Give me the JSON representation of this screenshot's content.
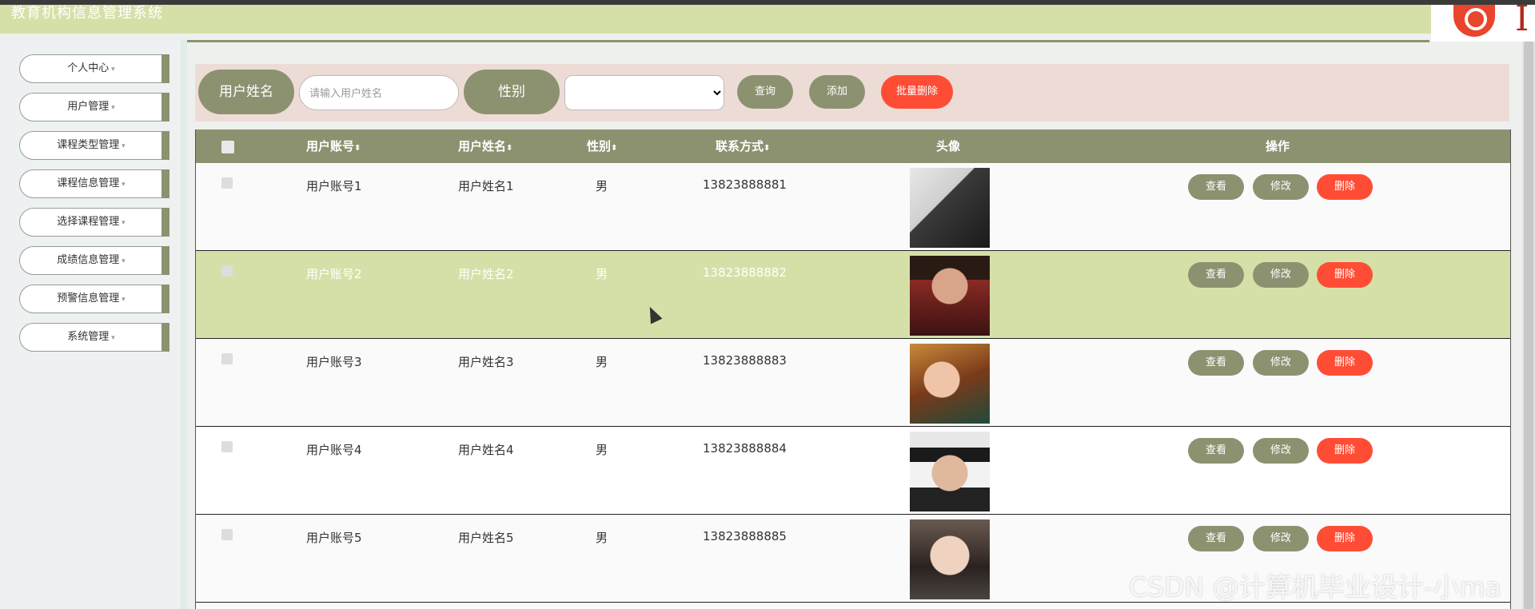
{
  "header": {
    "title": "教育机构信息管理系统"
  },
  "sidebar": {
    "items": [
      {
        "label": "个人中心"
      },
      {
        "label": "用户管理"
      },
      {
        "label": "课程类型管理"
      },
      {
        "label": "课程信息管理"
      },
      {
        "label": "选择课程管理"
      },
      {
        "label": "成绩信息管理"
      },
      {
        "label": "预警信息管理"
      },
      {
        "label": "系统管理"
      }
    ]
  },
  "search": {
    "name_label": "用户姓名",
    "name_placeholder": "请输入用户姓名",
    "gender_label": "性别",
    "gender_value": "",
    "query_button": "查询",
    "add_button": "添加",
    "batch_delete_button": "批量删除"
  },
  "table": {
    "columns": {
      "account": "用户账号",
      "name": "用户姓名",
      "gender": "性别",
      "phone": "联系方式",
      "avatar": "头像",
      "actions": "操作"
    },
    "sort_glyph": "⬍",
    "rows": [
      {
        "account": "用户账号1",
        "name": "用户姓名1",
        "gender": "男",
        "phone": "13823888881"
      },
      {
        "account": "用户账号2",
        "name": "用户姓名2",
        "gender": "男",
        "phone": "13823888882"
      },
      {
        "account": "用户账号3",
        "name": "用户姓名3",
        "gender": "男",
        "phone": "13823888883"
      },
      {
        "account": "用户账号4",
        "name": "用户姓名4",
        "gender": "男",
        "phone": "13823888884"
      },
      {
        "account": "用户账号5",
        "name": "用户姓名5",
        "gender": "男",
        "phone": "13823888885"
      }
    ],
    "actions": {
      "view": "查看",
      "edit": "修改",
      "delete": "删除"
    }
  },
  "watermark": "CSDN @计算机毕业设计-小ma",
  "colors": {
    "accent": "#8c9270",
    "danger": "#ff4d35",
    "header_bg": "#d5e0a8",
    "search_bg": "#eddcd6"
  }
}
